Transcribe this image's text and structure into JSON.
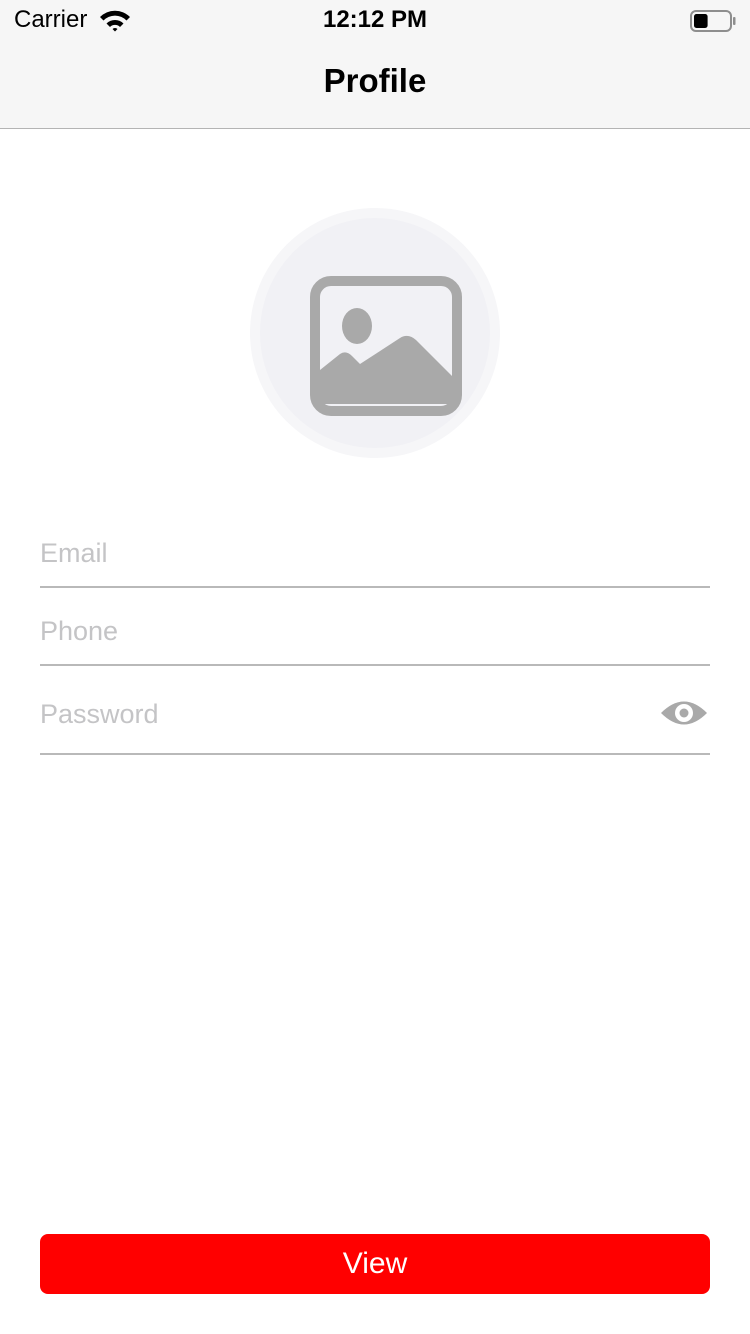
{
  "status_bar": {
    "carrier": "Carrier",
    "time": "12:12 PM",
    "wifi_icon": "wifi-icon",
    "battery_icon": "battery-icon",
    "battery_level": 0.4
  },
  "nav": {
    "title": "Profile"
  },
  "avatar": {
    "icon": "image-placeholder-icon"
  },
  "form": {
    "email_placeholder": "Email",
    "email_value": "",
    "phone_placeholder": "Phone",
    "phone_value": "",
    "password_placeholder": "Password",
    "password_value": "",
    "password_toggle_icon": "eye-icon"
  },
  "actions": {
    "view_label": "View"
  },
  "colors": {
    "accent": "#ff0000",
    "placeholder": "#c4c4c6",
    "divider": "#b9b9b9",
    "icon_gray": "#a9a9a9",
    "bar_background": "#f6f6f6"
  }
}
